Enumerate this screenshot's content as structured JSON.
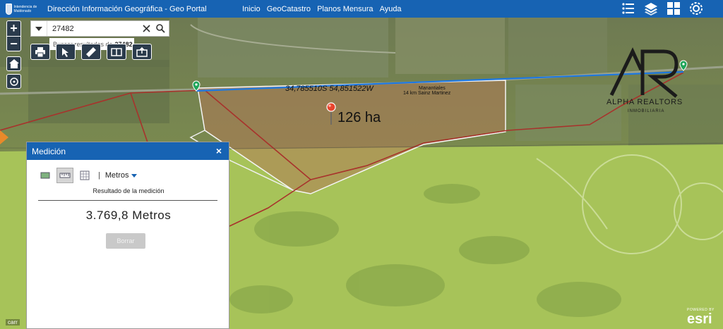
{
  "header": {
    "logo_text": "Intendencia de Maldonado",
    "title": "Dirección Información Geográfica - Geo Portal",
    "nav": [
      "Inicio",
      "GeoCatastro",
      "Planos Mensura",
      "Ayuda"
    ],
    "icons": [
      "list-icon",
      "layers-icon",
      "grid-icon",
      "settings-icon"
    ]
  },
  "map": {
    "zoom_in": "+",
    "zoom_out": "−",
    "search": {
      "value": "27482",
      "hint_prefix": "Buscar resultados de",
      "hint_value": "27482"
    },
    "coordinates_label": "34,785510S 54,851522W",
    "place_label_1": "Manantiales",
    "place_label_2": "14 km Sainz Martinez",
    "area_label": "126 ha",
    "watermark": {
      "name": "ALPHA REALTORS",
      "sub": "INMOBILIARIA"
    },
    "esri": {
      "powered": "POWERED BY",
      "brand": "esri"
    },
    "scale_fragment": "carr"
  },
  "measure_panel": {
    "title": "Medición",
    "close": "×",
    "unit": "Metros",
    "separator": "|",
    "result_title": "Resultado de la medición",
    "result_value": "3.769,8 Metros",
    "clear_label": "Borrar"
  }
}
